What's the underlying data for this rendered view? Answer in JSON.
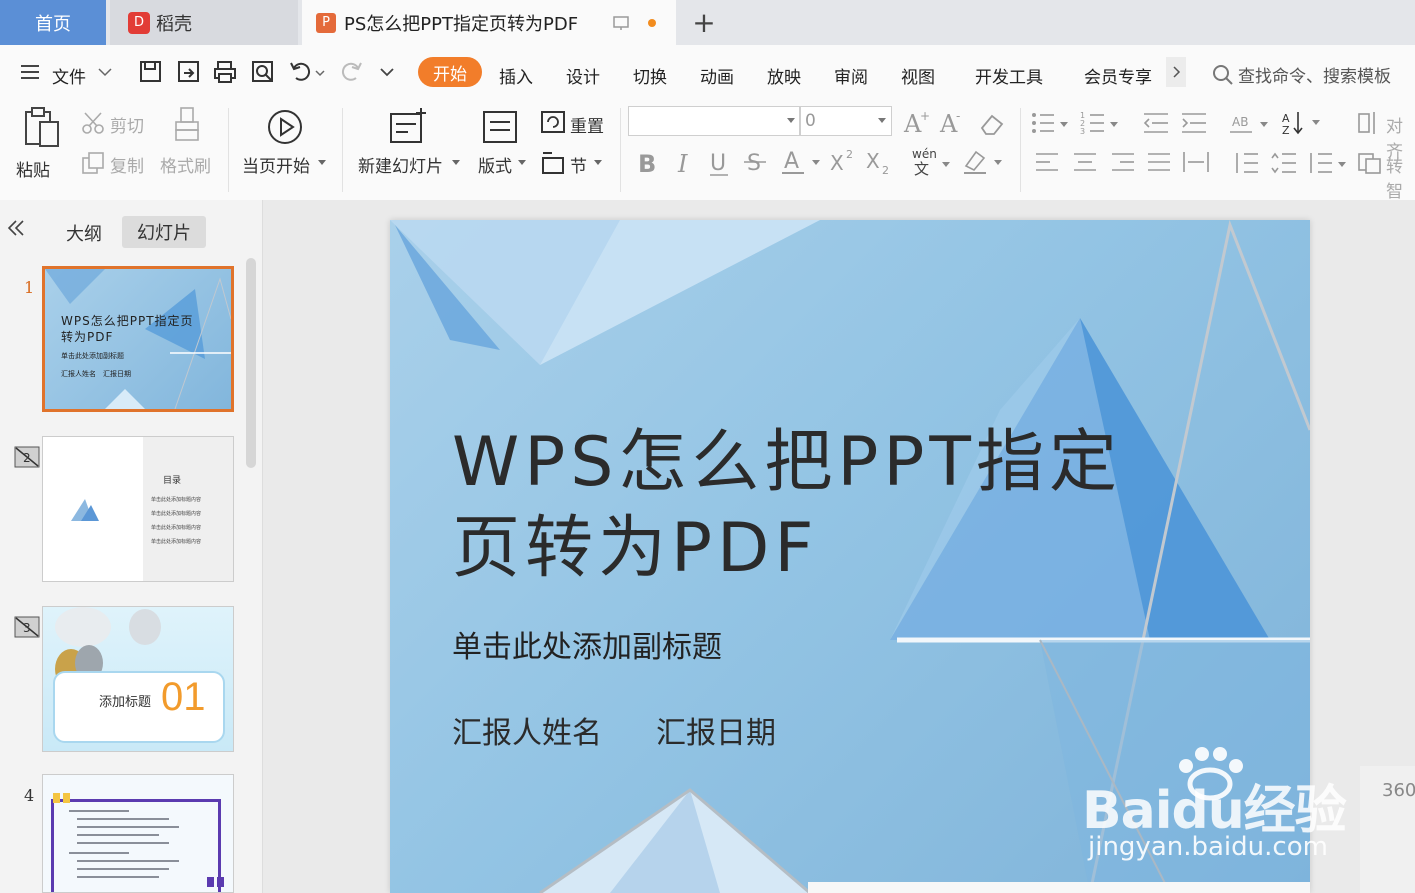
{
  "tabs": {
    "home": "首页",
    "daoke": "稻壳",
    "doc": "PS怎么把PPT指定页转为PDF",
    "daoke_logo": "D",
    "doc_logo": "P",
    "plus": "+"
  },
  "menu": {
    "file": "文件",
    "start": "开始",
    "insert": "插入",
    "design": "设计",
    "transition": "切换",
    "animation": "动画",
    "slideshow": "放映",
    "review": "审阅",
    "view": "视图",
    "devtools": "开发工具",
    "member": "会员专享",
    "search": "查找命令、搜索模板"
  },
  "ribbon": {
    "paste": "粘贴",
    "cut": "剪切",
    "copy": "复制",
    "format_painter": "格式刷",
    "from_current": "当页开始",
    "new_slide": "新建幻灯片",
    "layout": "版式",
    "reset": "重置",
    "section": "节",
    "font_size": "0",
    "align": "对齐",
    "convert": "转智"
  },
  "leftpanel": {
    "outline": "大纲",
    "slides": "幻灯片",
    "thumbs": [
      {
        "num": "1",
        "title": "WPS怎么把PPT指定页转为PDF",
        "sub": "单击此处添加副标题",
        "meta1": "汇报人姓名",
        "meta2": "汇报日期"
      },
      {
        "num": "2",
        "title": "目录",
        "items": [
          "单击此处添加标题内容",
          "单击此处添加标题内容",
          "单击此处添加标题内容",
          "单击此处添加标题内容"
        ]
      },
      {
        "num": "3",
        "title": "添加标题",
        "big": "01"
      },
      {
        "num": "4"
      }
    ]
  },
  "slide": {
    "title": "WPS怎么把PPT指定页转为PDF",
    "subtitle": "单击此处添加副标题",
    "reporter": "汇报人姓名",
    "date": "汇报日期"
  },
  "zoom": "360",
  "watermark": {
    "top": "Baidu经验",
    "bottom": "jingyan.baidu.com"
  },
  "colors": {
    "accent": "#f27d2a",
    "tab_blue": "#5b8fd6",
    "slide_blue": "#93c4e4"
  }
}
